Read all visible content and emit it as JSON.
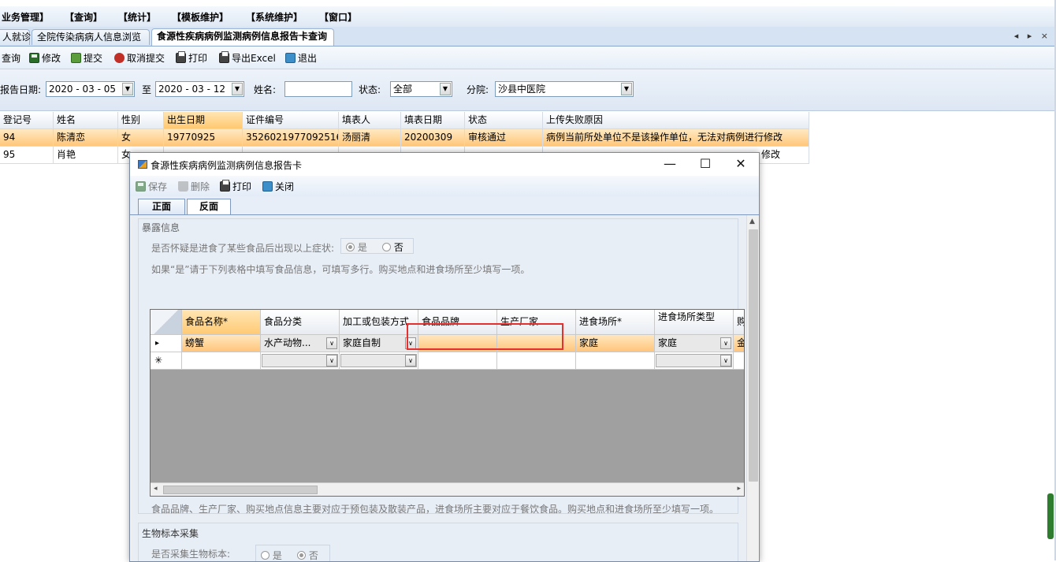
{
  "menubar": {
    "items": [
      "业务管理】",
      "【查询】",
      "【统计】",
      "【模板维护】",
      "【系统维护】",
      "【窗口】"
    ]
  },
  "tabs": {
    "items": [
      {
        "label": "人就诊"
      },
      {
        "label": "全院传染病病人信息浏览"
      },
      {
        "label": "食源性疾病病例监测病例信息报告卡查询"
      }
    ],
    "nav": "◂ ▸ ×"
  },
  "toolbar": {
    "query": "查询",
    "edit": "修改",
    "submit": "提交",
    "cancel_submit": "取消提交",
    "print": "打印",
    "export": "导出Excel",
    "exit": "退出"
  },
  "filter": {
    "report_date_label": "报告日期:",
    "date_from": "2020 - 03 - 05",
    "to_label": "至",
    "date_to": "2020 - 03 - 12",
    "name_label": "姓名:",
    "name_value": "",
    "status_label": "状态:",
    "status_value": "全部",
    "branch_label": "分院:",
    "branch_value": "沙县中医院"
  },
  "main_grid": {
    "headers": [
      "登记号",
      "姓名",
      "性别",
      "出生日期",
      "证件编号",
      "填表人",
      "填表日期",
      "状态",
      "上传失败原因"
    ],
    "rows": [
      [
        "94",
        "陈清恋",
        "女",
        "19770925",
        "352602197709251624",
        "汤丽清",
        "20200309",
        "审核通过",
        "病例当前所处单位不是该操作单位，无法对病例进行修改"
      ],
      [
        "95",
        "肖艳",
        "女",
        "",
        "",
        "",
        "",
        "",
        "修改"
      ]
    ]
  },
  "dialog": {
    "title": "食源性疾病病例监测病例信息报告卡",
    "controls": {
      "minimize": "—",
      "maximize": "☐",
      "close": "✕"
    },
    "toolbar": {
      "save": "保存",
      "delete": "删除",
      "print": "打印",
      "close": "关闭"
    },
    "tabs": [
      "正面",
      "反面"
    ],
    "exposure": {
      "title": "暴露信息",
      "question": "是否怀疑是进食了某些食品后出现以上症状:",
      "yes": "是",
      "no": "否",
      "hint": "如果“是”请于下列表格中填写食品信息，可填写多行。购买地点和进食场所至少填写一项。",
      "columns": [
        "食品名称*",
        "食品分类",
        "加工或包装方式",
        "食品品牌",
        "生产厂家",
        "进食场所*",
        "进食场所类型",
        "购"
      ],
      "row_marker": "▸",
      "new_marker": "✳",
      "rows": [
        [
          "螃蟹",
          "水产动物...",
          "家庭自制",
          "",
          "",
          "家庭",
          "家庭",
          "金"
        ]
      ],
      "note": "食品品牌、生产厂家、购买地点信息主要对应于预包装及散装产品，进食场所主要对应于餐饮食品。购买地点和进食场所至少填写一项。"
    },
    "bio": {
      "title": "生物标本采集",
      "question": "是否采集生物标本:",
      "yes": "是",
      "no": "否"
    }
  }
}
